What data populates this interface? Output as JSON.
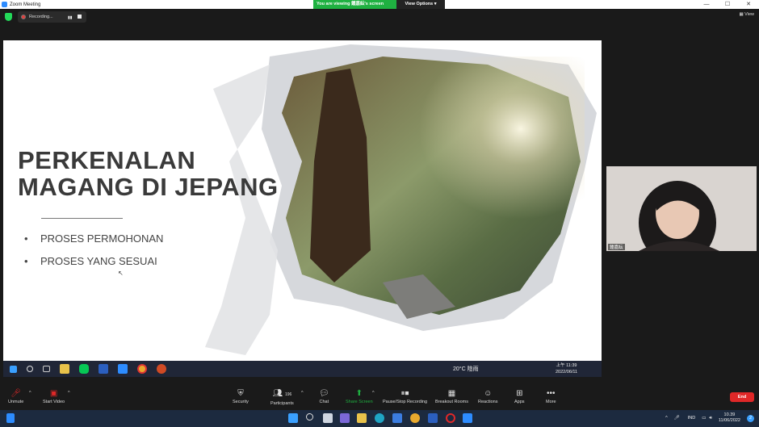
{
  "window": {
    "title": "Zoom Meeting",
    "minimize": "—",
    "maximize": "☐",
    "close": "✕"
  },
  "share_banner": {
    "viewing": "You are viewing 鍾嘉紜's screen",
    "view_options": "View Options ▾"
  },
  "topbar": {
    "recording": "Recording...",
    "view": "View"
  },
  "slide": {
    "title_line1": "PERKENALAN",
    "title_line2": "MAGANG DI JEPANG",
    "bullets": [
      "PROSES PERMOHONAN",
      "PROSES YANG SESUAI"
    ],
    "bullet_char": "•"
  },
  "shared_taskbar": {
    "weather": "20°C 陰雨",
    "time": "上午 11:39",
    "date": "2022/06/11"
  },
  "video": {
    "name": "鍾嘉紜"
  },
  "controls": {
    "unmute": "Unmute",
    "start_video": "Start Video",
    "security": "Security",
    "participants": "Participants",
    "participants_count": "196",
    "chat": "Chat",
    "share_screen": "Share Screen",
    "pause_stop_recording": "Pause/Stop Recording",
    "breakout_rooms": "Breakout Rooms",
    "reactions": "Reactions",
    "apps": "Apps",
    "more": "More",
    "end": "End"
  },
  "win_taskbar": {
    "lang": "IND",
    "time": "10.39",
    "date": "11/06/2022",
    "badge": "2"
  },
  "colors": {
    "share_green": "#1fb141",
    "end_red": "#e02828",
    "zoom_blue": "#2d8cff"
  }
}
